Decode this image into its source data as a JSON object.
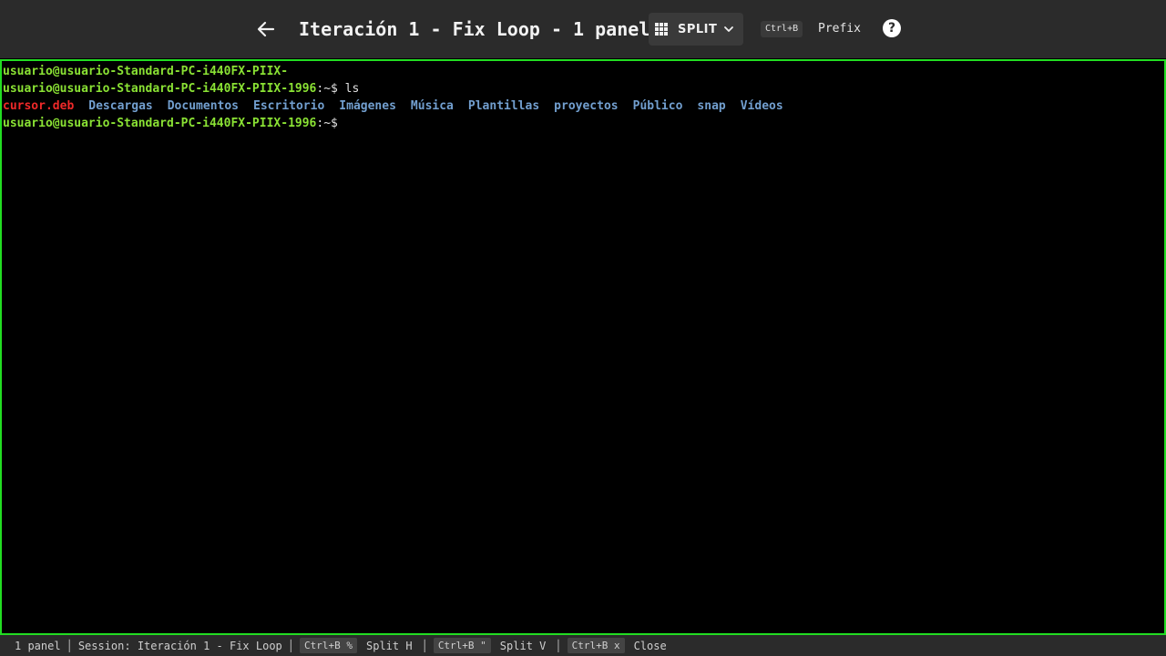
{
  "header": {
    "title": "Iteración 1 - Fix Loop - 1 panel",
    "split_label": "SPLIT",
    "prefix_key": "Ctrl+B",
    "prefix_label": "Prefix",
    "help_label": "?"
  },
  "terminal": {
    "line1": "usuario@usuario-Standard-PC-i440FX-PIIX-",
    "line2_prompt": "usuario@usuario-Standard-PC-i440FX-PIIX-1996",
    "line2_rest": ":~$ ls",
    "ls_entries": [
      {
        "name": "cursor.deb",
        "kind": "exec"
      },
      {
        "name": "Descargas",
        "kind": "dir"
      },
      {
        "name": "Documentos",
        "kind": "dir"
      },
      {
        "name": "Escritorio",
        "kind": "dir"
      },
      {
        "name": "Imágenes",
        "kind": "dir"
      },
      {
        "name": "Música",
        "kind": "dir"
      },
      {
        "name": "Plantillas",
        "kind": "dir"
      },
      {
        "name": "proyectos",
        "kind": "dir"
      },
      {
        "name": "Público",
        "kind": "dir"
      },
      {
        "name": "snap",
        "kind": "dir"
      },
      {
        "name": "Vídeos",
        "kind": "dir"
      }
    ],
    "line4_prompt": "usuario@usuario-Standard-PC-i440FX-PIIX-1996",
    "line4_rest": ":~$"
  },
  "status": {
    "panels": "1 panel",
    "session": "Session: Iteración 1 - Fix Loop",
    "split_h_key": "Ctrl+B %",
    "split_h_label": "Split H",
    "split_v_key": "Ctrl+B \"",
    "split_v_label": "Split V",
    "close_key": "Ctrl+B x",
    "close_label": "Close"
  },
  "colors": {
    "pane_border": "#22dd22",
    "prompt": "#8ae234",
    "executable": "#ef2929",
    "directory": "#729fcf"
  }
}
